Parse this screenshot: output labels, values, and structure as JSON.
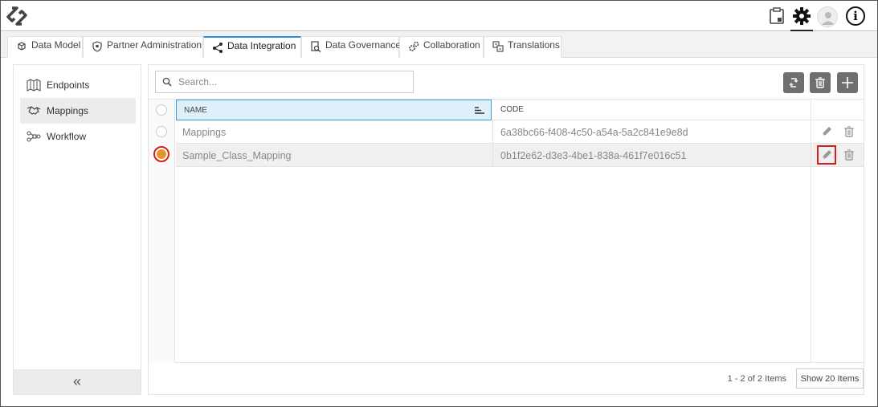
{
  "tabs": [
    {
      "label": "Data Model",
      "icon": "cubes-icon"
    },
    {
      "label": "Partner Administration",
      "icon": "shield-icon"
    },
    {
      "label": "Data Integration",
      "icon": "share-icon"
    },
    {
      "label": "Data Governance",
      "icon": "doc-search-icon"
    },
    {
      "label": "Collaboration",
      "icon": "gears-icon"
    },
    {
      "label": "Translations",
      "icon": "translate-icon"
    }
  ],
  "active_tab": "Data Integration",
  "sidebar": {
    "items": [
      {
        "label": "Endpoints",
        "icon": "map-icon"
      },
      {
        "label": "Mappings",
        "icon": "handshake-icon"
      },
      {
        "label": "Workflow",
        "icon": "workflow-icon"
      }
    ],
    "active": "Mappings",
    "collapse_label": "«"
  },
  "search": {
    "placeholder": "Search..."
  },
  "grid": {
    "columns": [
      "NAME",
      "CODE"
    ],
    "rows": [
      {
        "name": "Mappings",
        "code": "6a38bc66-f408-4c50-a54a-5a2c841e9e8d",
        "selected": false
      },
      {
        "name": "Sample_Class_Mapping",
        "code": "0b1f2e62-d3e3-4be1-838a-461f7e016c51",
        "selected": true
      }
    ]
  },
  "footer": {
    "pager": "1 - 2 of 2 Items",
    "page_size": "Show 20 Items"
  },
  "colors": {
    "accent": "#2e8fd8",
    "highlight": "#d02020",
    "toolbar_button": "#6f6f6f",
    "check_selected": "#e8942a"
  }
}
